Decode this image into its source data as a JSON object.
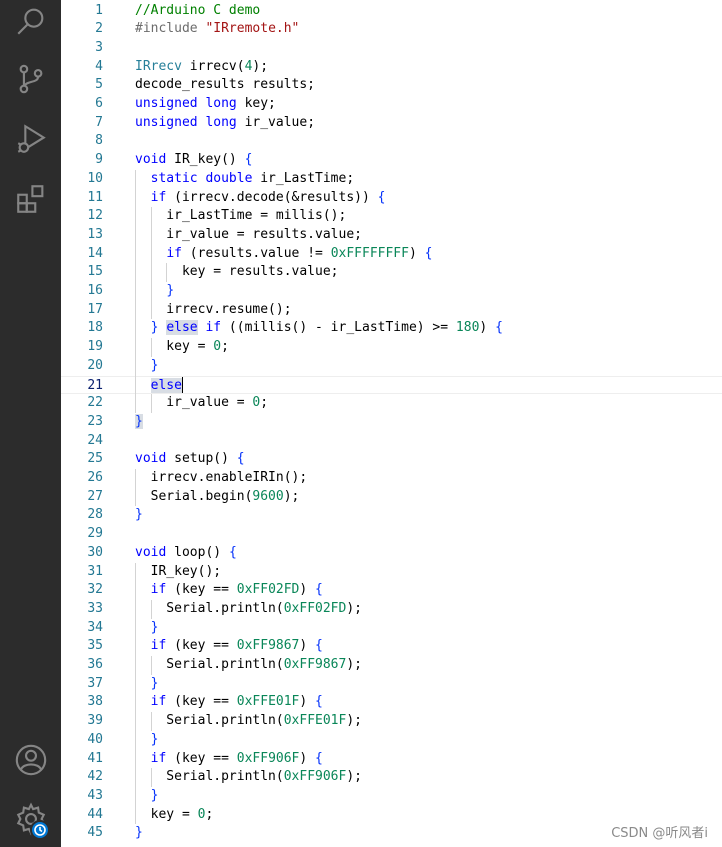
{
  "activity_bar": {
    "items": [
      {
        "name": "search-icon"
      },
      {
        "name": "source-control-icon"
      },
      {
        "name": "run-debug-icon"
      },
      {
        "name": "extensions-icon"
      }
    ],
    "bottom": [
      {
        "name": "account-icon"
      },
      {
        "name": "manage-gear-icon"
      }
    ]
  },
  "editor": {
    "lines": [
      {
        "n": "1",
        "code": [
          [
            "cmt",
            "//Arduino C demo"
          ]
        ]
      },
      {
        "n": "2",
        "code": [
          [
            "pre",
            "#include "
          ],
          [
            "str",
            "\"IRremote.h\""
          ]
        ]
      },
      {
        "n": "3",
        "code": []
      },
      {
        "n": "4",
        "code": [
          [
            "type",
            "IRrecv"
          ],
          [
            "",
            " irrecv("
          ],
          [
            "num",
            "4"
          ],
          [
            "",
            ");"
          ]
        ]
      },
      {
        "n": "5",
        "code": [
          [
            "",
            "decode_results results;"
          ]
        ]
      },
      {
        "n": "6",
        "code": [
          [
            "kw",
            "unsigned long"
          ],
          [
            "",
            " key;"
          ]
        ]
      },
      {
        "n": "7",
        "code": [
          [
            "kw",
            "unsigned long"
          ],
          [
            "",
            " ir_value;"
          ]
        ]
      },
      {
        "n": "8",
        "code": []
      },
      {
        "n": "9",
        "code": [
          [
            "kw",
            "void"
          ],
          [
            "",
            " IR_key() "
          ],
          [
            "br",
            "{"
          ]
        ]
      },
      {
        "n": "10",
        "code": [
          [
            "",
            "  "
          ],
          [
            "kw",
            "static double"
          ],
          [
            "",
            " ir_LastTime;"
          ]
        ]
      },
      {
        "n": "11",
        "code": [
          [
            "",
            "  "
          ],
          [
            "kw",
            "if"
          ],
          [
            "",
            " (irrecv.decode(&results)) "
          ],
          [
            "br",
            "{"
          ]
        ]
      },
      {
        "n": "12",
        "code": [
          [
            "",
            "    ir_LastTime = millis();"
          ]
        ]
      },
      {
        "n": "13",
        "code": [
          [
            "",
            "    ir_value = results.value;"
          ]
        ]
      },
      {
        "n": "14",
        "code": [
          [
            "",
            "    "
          ],
          [
            "kw",
            "if"
          ],
          [
            "",
            " (results.value != "
          ],
          [
            "num",
            "0xFFFFFFFF"
          ],
          [
            "",
            ") "
          ],
          [
            "br",
            "{"
          ]
        ]
      },
      {
        "n": "15",
        "code": [
          [
            "",
            "      key = results.value;"
          ]
        ]
      },
      {
        "n": "16",
        "code": [
          [
            "",
            "    "
          ],
          [
            "br",
            "}"
          ]
        ]
      },
      {
        "n": "17",
        "code": [
          [
            "",
            "    irrecv.resume();"
          ]
        ]
      },
      {
        "n": "18",
        "code": [
          [
            "",
            "  "
          ],
          [
            "br",
            "}"
          ],
          [
            "",
            " "
          ],
          [
            "kwhl",
            "else"
          ],
          [
            "",
            " "
          ],
          [
            "kw",
            "if"
          ],
          [
            "",
            " ((millis() - ir_LastTime) >= "
          ],
          [
            "num",
            "180"
          ],
          [
            "",
            ") "
          ],
          [
            "br",
            "{"
          ]
        ]
      },
      {
        "n": "19",
        "code": [
          [
            "",
            "    key = "
          ],
          [
            "num",
            "0"
          ],
          [
            "",
            ";"
          ]
        ]
      },
      {
        "n": "20",
        "code": [
          [
            "",
            "  "
          ],
          [
            "br",
            "}"
          ]
        ]
      },
      {
        "n": "21",
        "code": [
          [
            "",
            "  "
          ],
          [
            "kwhl",
            "else"
          ],
          [
            "cursor",
            ""
          ]
        ],
        "current": true
      },
      {
        "n": "22",
        "code": [
          [
            "",
            "    ir_value = "
          ],
          [
            "num",
            "0"
          ],
          [
            "",
            ";"
          ]
        ]
      },
      {
        "n": "23",
        "code": [
          [
            "brhl",
            "}"
          ]
        ]
      },
      {
        "n": "24",
        "code": []
      },
      {
        "n": "25",
        "code": [
          [
            "kw",
            "void"
          ],
          [
            "",
            " setup() "
          ],
          [
            "br",
            "{"
          ]
        ]
      },
      {
        "n": "26",
        "code": [
          [
            "",
            "  irrecv.enableIRIn();"
          ]
        ]
      },
      {
        "n": "27",
        "code": [
          [
            "",
            "  Serial.begin("
          ],
          [
            "num",
            "9600"
          ],
          [
            "",
            ");"
          ]
        ]
      },
      {
        "n": "28",
        "code": [
          [
            "br",
            "}"
          ]
        ]
      },
      {
        "n": "29",
        "code": []
      },
      {
        "n": "30",
        "code": [
          [
            "kw",
            "void"
          ],
          [
            "",
            " loop() "
          ],
          [
            "br",
            "{"
          ]
        ]
      },
      {
        "n": "31",
        "code": [
          [
            "",
            "  IR_key();"
          ]
        ]
      },
      {
        "n": "32",
        "code": [
          [
            "",
            "  "
          ],
          [
            "kw",
            "if"
          ],
          [
            "",
            " (key == "
          ],
          [
            "num",
            "0xFF02FD"
          ],
          [
            "",
            ") "
          ],
          [
            "br",
            "{"
          ]
        ]
      },
      {
        "n": "33",
        "code": [
          [
            "",
            "    Serial.println("
          ],
          [
            "num",
            "0xFF02FD"
          ],
          [
            "",
            ");"
          ]
        ]
      },
      {
        "n": "34",
        "code": [
          [
            "",
            "  "
          ],
          [
            "br",
            "}"
          ]
        ]
      },
      {
        "n": "35",
        "code": [
          [
            "",
            "  "
          ],
          [
            "kw",
            "if"
          ],
          [
            "",
            " (key == "
          ],
          [
            "num",
            "0xFF9867"
          ],
          [
            "",
            ") "
          ],
          [
            "br",
            "{"
          ]
        ]
      },
      {
        "n": "36",
        "code": [
          [
            "",
            "    Serial.println("
          ],
          [
            "num",
            "0xFF9867"
          ],
          [
            "",
            ");"
          ]
        ]
      },
      {
        "n": "37",
        "code": [
          [
            "",
            "  "
          ],
          [
            "br",
            "}"
          ]
        ]
      },
      {
        "n": "38",
        "code": [
          [
            "",
            "  "
          ],
          [
            "kw",
            "if"
          ],
          [
            "",
            " (key == "
          ],
          [
            "num",
            "0xFFE01F"
          ],
          [
            "",
            ") "
          ],
          [
            "br",
            "{"
          ]
        ]
      },
      {
        "n": "39",
        "code": [
          [
            "",
            "    Serial.println("
          ],
          [
            "num",
            "0xFFE01F"
          ],
          [
            "",
            ");"
          ]
        ]
      },
      {
        "n": "40",
        "code": [
          [
            "",
            "  "
          ],
          [
            "br",
            "}"
          ]
        ]
      },
      {
        "n": "41",
        "code": [
          [
            "",
            "  "
          ],
          [
            "kw",
            "if"
          ],
          [
            "",
            " (key == "
          ],
          [
            "num",
            "0xFF906F"
          ],
          [
            "",
            ") "
          ],
          [
            "br",
            "{"
          ]
        ]
      },
      {
        "n": "42",
        "code": [
          [
            "",
            "    Serial.println("
          ],
          [
            "num",
            "0xFF906F"
          ],
          [
            "",
            ");"
          ]
        ]
      },
      {
        "n": "43",
        "code": [
          [
            "",
            "  "
          ],
          [
            "br",
            "}"
          ]
        ]
      },
      {
        "n": "44",
        "code": [
          [
            "",
            "  key = "
          ],
          [
            "num",
            "0"
          ],
          [
            "",
            ";"
          ]
        ]
      },
      {
        "n": "45",
        "code": [
          [
            "br",
            "}"
          ]
        ]
      }
    ]
  },
  "watermark": {
    "text": "CSDN @听风者i"
  },
  "colors": {
    "activity_bg": "#2c2c2c",
    "line_number": "#237893",
    "keyword": "#0000ff",
    "string": "#a31515",
    "comment": "#008000",
    "number": "#098658",
    "type": "#267f99"
  }
}
